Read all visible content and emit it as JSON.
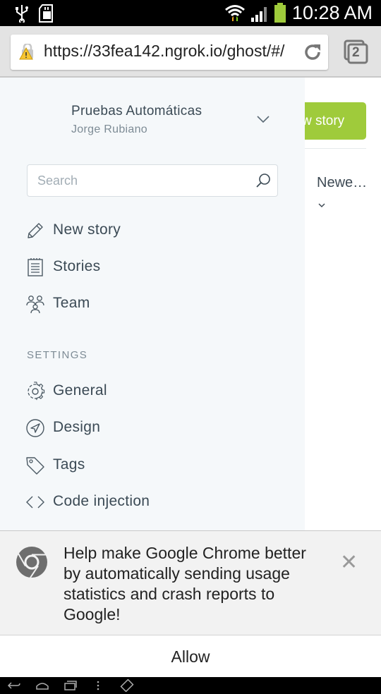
{
  "status_bar": {
    "time": "10:28 AM"
  },
  "browser": {
    "url": "https://33fea142.ngrok.io/ghost/#/",
    "tab_count": "2"
  },
  "page": {
    "new_story_button": "w story",
    "sort_filter": "Newe…"
  },
  "sidebar": {
    "blog_title": "Pruebas Automáticas",
    "user_name": "Jorge Rubiano",
    "search_placeholder": "Search",
    "nav_items": [
      {
        "label": "New story",
        "icon": "pencil-icon"
      },
      {
        "label": "Stories",
        "icon": "document-icon"
      },
      {
        "label": "Team",
        "icon": "team-icon"
      }
    ],
    "settings_heading": "SETTINGS",
    "settings_items": [
      {
        "label": "General",
        "icon": "gear-icon"
      },
      {
        "label": "Design",
        "icon": "compass-icon"
      },
      {
        "label": "Tags",
        "icon": "tag-icon"
      },
      {
        "label": "Code injection",
        "icon": "code-icon"
      }
    ]
  },
  "infobar": {
    "message": "Help make Google Chrome better by automatically sending usage statistics and crash reports to Google!",
    "allow_label": "Allow"
  },
  "colors": {
    "accent_green": "#9fcb3b",
    "sidebar_bg": "#f5f8fa",
    "text_dark": "#3b4a55",
    "text_muted": "#7d8b95"
  }
}
